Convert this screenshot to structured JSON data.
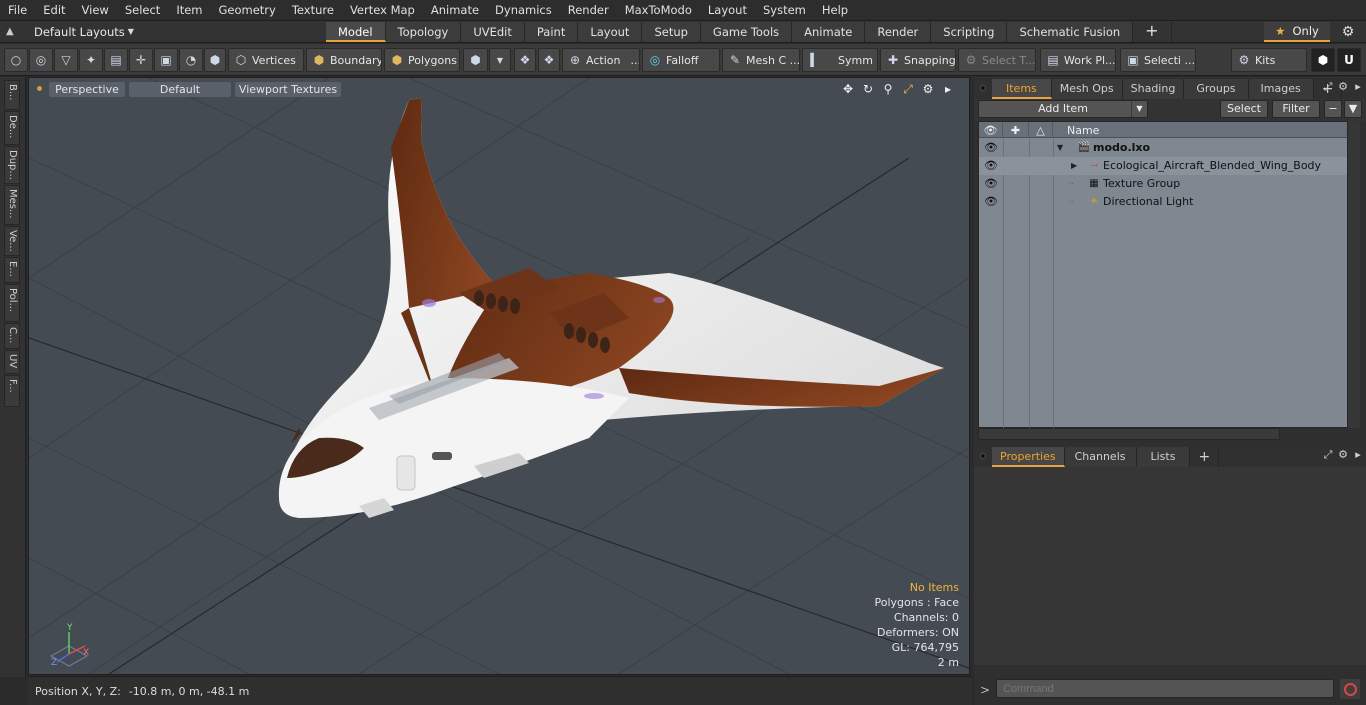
{
  "menu": [
    "File",
    "Edit",
    "View",
    "Select",
    "Item",
    "Geometry",
    "Texture",
    "Vertex Map",
    "Animate",
    "Dynamics",
    "Render",
    "MaxToModo",
    "Layout",
    "System",
    "Help"
  ],
  "layout_bar": {
    "layout_name": "Default Layouts",
    "tabs": [
      "Model",
      "Topology",
      "UVEdit",
      "Paint",
      "Layout",
      "Setup",
      "Game Tools",
      "Animate",
      "Render",
      "Scripting",
      "Schematic Fusion"
    ],
    "active_tab": "Model",
    "only_label": "Only"
  },
  "toolbar": {
    "vertices": "Vertices",
    "boundary": "Boundary",
    "polygons": "Polygons",
    "action": "Action",
    "falloff": "Falloff",
    "mesh_constraints": "Mesh C ...",
    "symmetry": "Symm ...",
    "snapping": "Snapping",
    "select_through": "Select T...",
    "work_plane": "Work Pl...",
    "selection_sets": "Selecti ...",
    "kits": "Kits"
  },
  "left_tabs": [
    "B...",
    "De...",
    "Dup...",
    "Mes...",
    "Ve...",
    "E...",
    "Pol...",
    "C...",
    "UV",
    "F..."
  ],
  "viewport": {
    "projection": "Perspective",
    "style": "Default",
    "shading": "Viewport Textures",
    "info": {
      "status": "No Items",
      "polygons": "Polygons : Face",
      "channels": "Channels: 0",
      "deformers": "Deformers: ON",
      "gl": "GL: 764,795",
      "scale": "2 m"
    },
    "axis_labels": {
      "y": "Y",
      "x": "X",
      "z": "Z"
    }
  },
  "status_bar": {
    "label": "Position X, Y, Z:",
    "value": "-10.8 m, 0 m, -48.1 m"
  },
  "items_panel": {
    "tabs": [
      "Items",
      "Mesh Ops",
      "Shading",
      "Groups",
      "Images"
    ],
    "active_tab": "Items",
    "add_item": "Add Item",
    "select": "Select",
    "filter": "Filter",
    "column_name": "Name",
    "rows": [
      {
        "label": "modo.lxo",
        "level": 0,
        "bold": true
      },
      {
        "label": "Ecological_Aircraft_Blended_Wing_Body",
        "level": 1,
        "bold": false
      },
      {
        "label": "Texture Group",
        "level": 1,
        "bold": false
      },
      {
        "label": "Directional Light",
        "level": 1,
        "bold": false
      }
    ]
  },
  "properties_panel": {
    "tabs": [
      "Properties",
      "Channels",
      "Lists"
    ],
    "active_tab": "Properties"
  },
  "command": {
    "prompt": ">",
    "placeholder": "Command"
  },
  "colors": {
    "accent": "#e8a33a",
    "aircraft_body": "#f2f2f2",
    "aircraft_brown": "#7a3a1c",
    "viewport_bg": "#454b52"
  }
}
